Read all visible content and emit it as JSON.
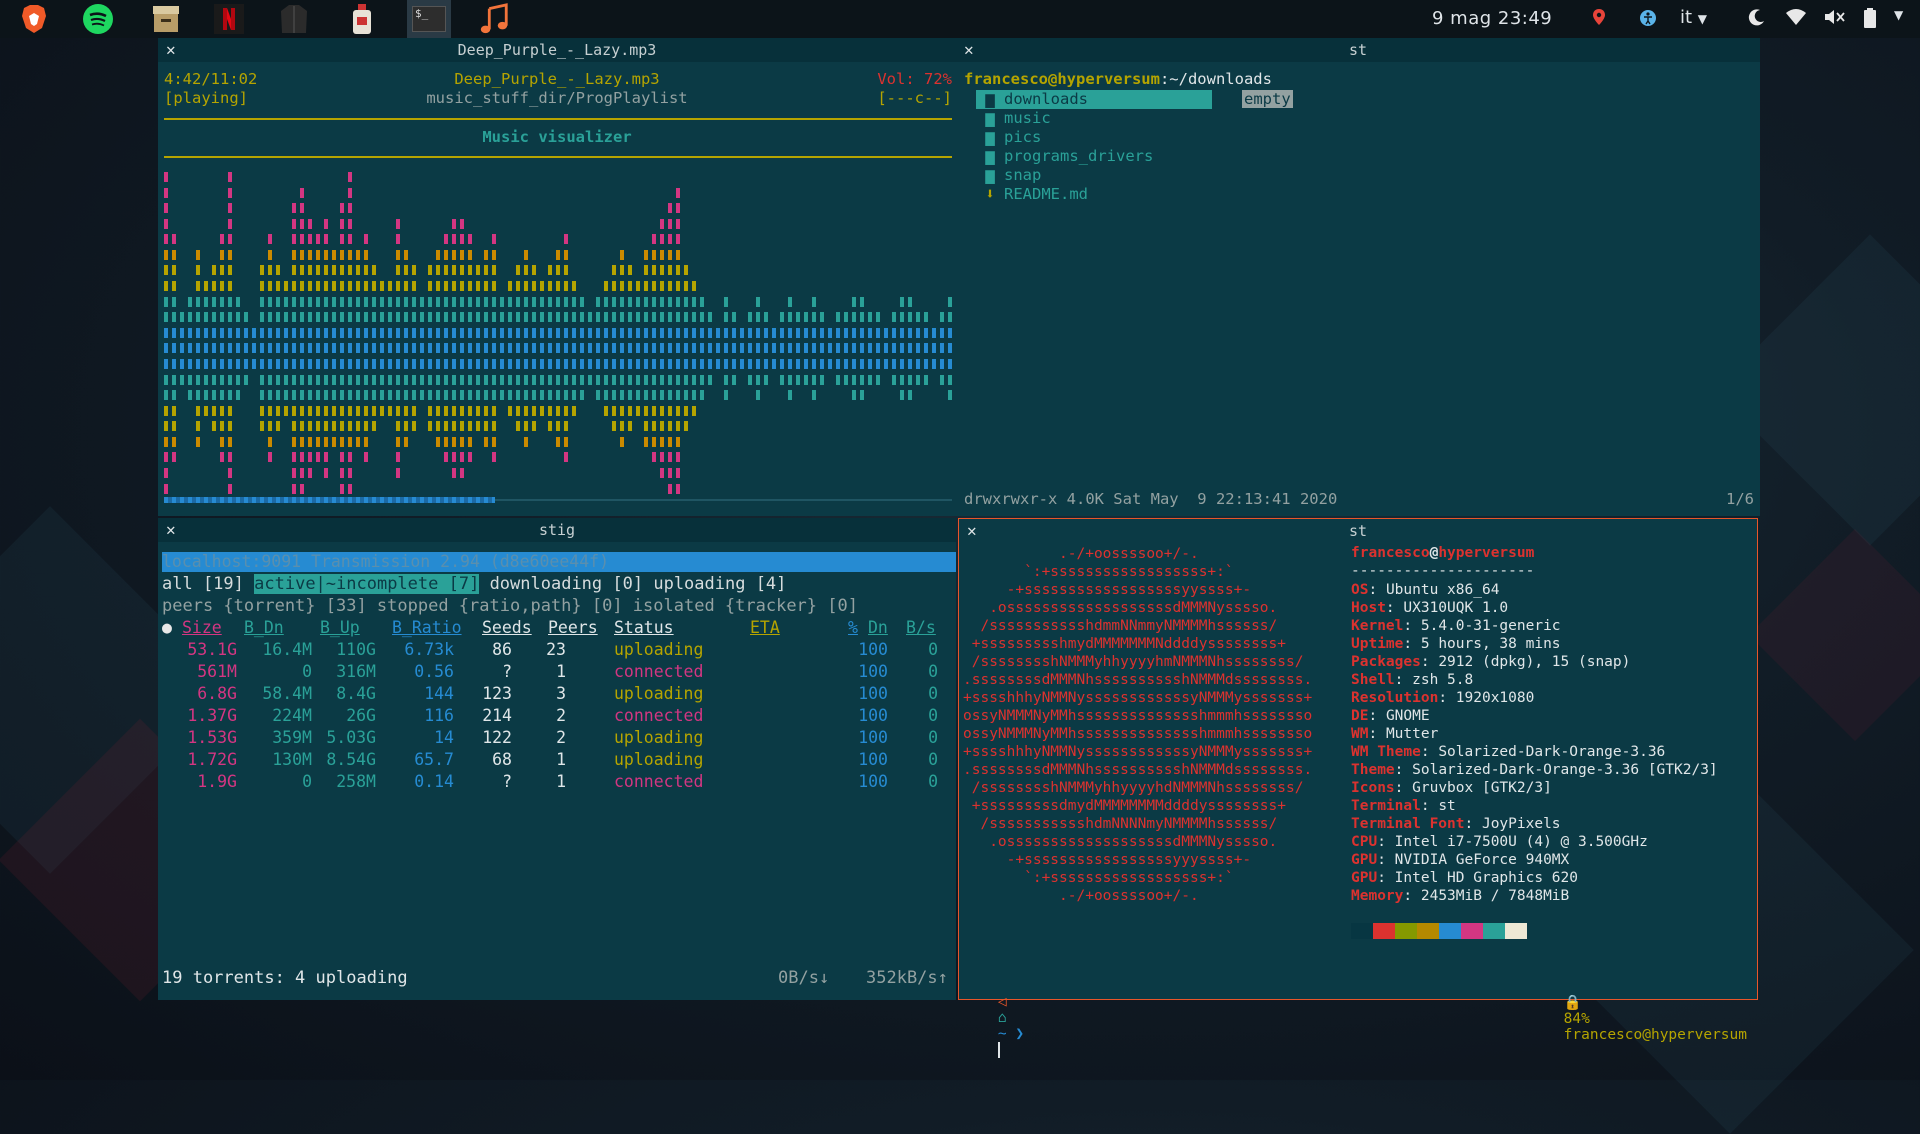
{
  "topbar": {
    "apps": [
      {
        "icon": "brave-lion-icon"
      },
      {
        "icon": "spotify-icon"
      },
      {
        "icon": "archive-icon"
      },
      {
        "icon": "netflix-icon"
      },
      {
        "icon": "jacket-icon"
      },
      {
        "icon": "bottle-icon"
      },
      {
        "icon": "terminal-icon",
        "label": "$_"
      },
      {
        "icon": "music-note-icon"
      }
    ],
    "clock": "9 mag 23:49",
    "keyboard_layout": "it",
    "tray_icons": [
      "location-pin-icon",
      "accessibility-icon",
      "night-mode-icon",
      "wifi-icon",
      "volume-muted-icon",
      "battery-icon",
      "chevron-down-icon"
    ]
  },
  "music": {
    "window_title": "Deep_Purple_-_Lazy.mp3",
    "elapsed": "4:42/11:02",
    "state": "[playing]",
    "track": "Deep_Purple_-_Lazy.mp3",
    "playlist": "music_stuff_dir/ProgPlaylist",
    "volume": "Vol: 72%",
    "flags": "[---c--]",
    "section_title": "Music visualizer",
    "progress": 0.42
  },
  "files": {
    "window_title": "st",
    "prompt_user": "francesco@hyperversum",
    "prompt_path": ":~/downloads",
    "entries": [
      {
        "name": "downloads",
        "type": "folder",
        "selected": true
      },
      {
        "name": "music",
        "type": "folder"
      },
      {
        "name": "pics",
        "type": "folder"
      },
      {
        "name": "programs_drivers",
        "type": "folder"
      },
      {
        "name": "snap",
        "type": "folder"
      },
      {
        "name": "README.md",
        "type": "file"
      }
    ],
    "preview": "empty",
    "status_line": "drwxrwxr-x 4.0K Sat May  9 22:13:41 2020",
    "position": "1/6"
  },
  "stig": {
    "window_title": "stig",
    "host_line": "localhost:9091 Transmission 2.94 (d8e60ee44f)",
    "tabs_all": "all [19]",
    "tab_active": "active|~incomplete [7]",
    "tab_downloading": "downloading [0]",
    "tab_uploading": "uploading [4]",
    "tabs_line2": "peers {torrent} [33] stopped {ratio,path} [0] isolated {tracker} [0]",
    "headers": [
      "Size",
      "B_Dn",
      "B_Up",
      "B_Ratio",
      "Seeds",
      "Peers",
      "Status",
      "ETA",
      "%",
      "Dn",
      "B/s"
    ],
    "rows": [
      {
        "size": "53.1G",
        "dn": "16.4M",
        "up": "110G",
        "ratio": "6.73k",
        "seeds": "86",
        "peers": "23",
        "status": "uploading",
        "pct": "100",
        "rate": "0"
      },
      {
        "size": "561M",
        "dn": "0",
        "up": "316M",
        "ratio": "0.56",
        "seeds": "?",
        "peers": "1",
        "status": "connected",
        "pct": "100",
        "rate": "0"
      },
      {
        "size": "6.8G",
        "dn": "58.4M",
        "up": "8.4G",
        "ratio": "144",
        "seeds": "123",
        "peers": "3",
        "status": "uploading",
        "pct": "100",
        "rate": "0"
      },
      {
        "size": "1.37G",
        "dn": "224M",
        "up": "26G",
        "ratio": "116",
        "seeds": "214",
        "peers": "2",
        "status": "connected",
        "pct": "100",
        "rate": "0"
      },
      {
        "size": "1.53G",
        "dn": "359M",
        "up": "5.03G",
        "ratio": "14",
        "seeds": "122",
        "peers": "2",
        "status": "uploading",
        "pct": "100",
        "rate": "0"
      },
      {
        "size": "1.72G",
        "dn": "130M",
        "up": "8.54G",
        "ratio": "65.7",
        "seeds": "68",
        "peers": "1",
        "status": "uploading",
        "pct": "100",
        "rate": "0"
      },
      {
        "size": "1.9G",
        "dn": "0",
        "up": "258M",
        "ratio": "0.14",
        "seeds": "?",
        "peers": "1",
        "status": "connected",
        "pct": "100",
        "rate": "0"
      }
    ],
    "footer_left": "19 torrents: 4 uploading",
    "footer_down": "0B/s↓",
    "footer_up": "352kB/s↑"
  },
  "neofetch": {
    "window_title": "st",
    "ascii": [
      "           .-/+oossssoo+/-.",
      "       `:+ssssssssssssssssss+:`",
      "     -+ssssssssssssssssssyyssss+-",
      "   .osssssssssssssssssssdMMMNysssso.",
      "  /ssssssssssshdmmNNmmyNMMMMhssssss/",
      " +ssssssssshmydMMMMMMMNddddyssssssss+",
      " /sssssssshNMMMyhhyyyyhmNMMMNhssssssss/",
      ".ssssssssdMMMNhsssssssssshNMMMdssssssss.",
      "+sssshhhyNMMNyssssssssssssyNMMMysssssss+",
      "ossyNMMMNyMMhsssssssssssssshmmmhssssssso",
      "ossyNMMMNyMMhsssssssssssssshmmmhssssssso",
      "+sssshhhyNMMNyssssssssssssyNMMMysssssss+",
      ".ssssssssdMMMNhsssssssssshNMMMdssssssss.",
      " /sssssssshNMMMyhhyyyyhdNMMMNhssssssss/",
      " +sssssssssdmydMMMMMMMMddddyssssssss+",
      "  /ssssssssssshdmNNNNmyNMMMMhssssss/",
      "   .osssssssssssssssssssdMMMNysssso.",
      "     -+sssssssssssssssssyyyssss+-",
      "       `:+ssssssssssssssssss+:`",
      "           .-/+oossssoo+/-."
    ],
    "user": "francesco",
    "at": "@",
    "host": "hyperversum",
    "separator": "---------------------",
    "info": [
      {
        "key": "OS",
        "value": "Ubuntu x86_64"
      },
      {
        "key": "Host",
        "value": "UX310UQK 1.0"
      },
      {
        "key": "Kernel",
        "value": "5.4.0-31-generic"
      },
      {
        "key": "Uptime",
        "value": "5 hours, 38 mins"
      },
      {
        "key": "Packages",
        "value": "2912 (dpkg), 15 (snap)"
      },
      {
        "key": "Shell",
        "value": "zsh 5.8"
      },
      {
        "key": "Resolution",
        "value": "1920x1080"
      },
      {
        "key": "DE",
        "value": "GNOME"
      },
      {
        "key": "WM",
        "value": "Mutter"
      },
      {
        "key": "WM Theme",
        "value": "Solarized-Dark-Orange-3.36"
      },
      {
        "key": "Theme",
        "value": "Solarized-Dark-Orange-3.36 [GTK2/3]"
      },
      {
        "key": "Icons",
        "value": "Gruvbox [GTK2/3]"
      },
      {
        "key": "Terminal",
        "value": "st"
      },
      {
        "key": "Terminal Font",
        "value": "JoyPixels"
      },
      {
        "key": "CPU",
        "value": "Intel i7-7500U (4) @ 3.500GHz"
      },
      {
        "key": "GPU",
        "value": "NVIDIA GeForce 940MX"
      },
      {
        "key": "GPU",
        "value": "Intel HD Graphics 620"
      },
      {
        "key": "Memory",
        "value": "2453MiB / 7848MiB"
      }
    ],
    "palette": [
      "#073642",
      "#dc322f",
      "#859900",
      "#b58900",
      "#268bd2",
      "#d33682",
      "#2aa198",
      "#eee8d5"
    ],
    "prompt_symbol": "~ ❯",
    "battery": "84%",
    "prompt_right": "francesco@hyperversum"
  },
  "colors": {
    "accent_orange": "#e8562a",
    "accent_cyan": "#2aa198",
    "accent_yellow": "#b5a400",
    "accent_blue": "#268bd2",
    "accent_magenta": "#d33682",
    "accent_red": "#dc322f"
  }
}
